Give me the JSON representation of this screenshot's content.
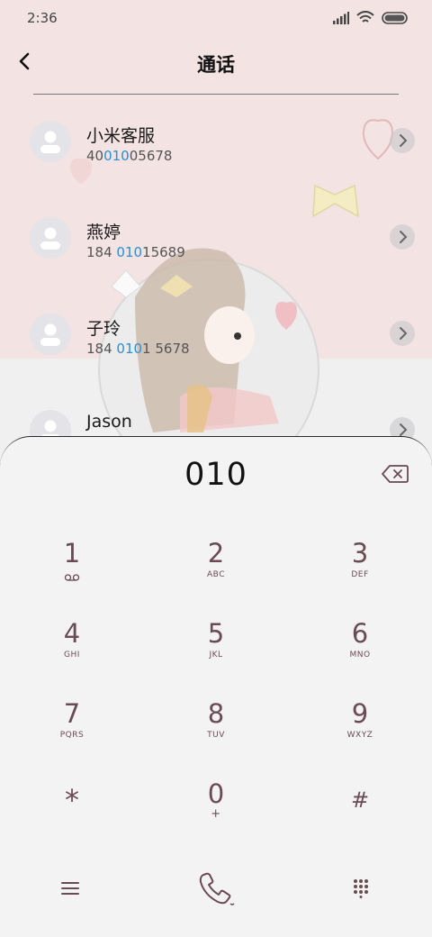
{
  "status_bar": {
    "time": "2:36"
  },
  "header": {
    "title": "通话"
  },
  "contacts": [
    {
      "name": "小米客服",
      "num_pre": "40",
      "num_hl": "010",
      "num_post": "05678"
    },
    {
      "name": "燕婷",
      "num_pre": "184 ",
      "num_hl": "010",
      "num_post": "15689"
    },
    {
      "name": "子玲",
      "num_pre": "184 ",
      "num_hl": "010",
      "num_post": "1 5678"
    },
    {
      "name": "Jason",
      "num_pre": "",
      "num_hl": "",
      "num_post": ""
    }
  ],
  "dialer": {
    "number": "010",
    "keys": [
      {
        "digit": "1",
        "letters": ""
      },
      {
        "digit": "2",
        "letters": "ABC"
      },
      {
        "digit": "3",
        "letters": "DEF"
      },
      {
        "digit": "4",
        "letters": "GHI"
      },
      {
        "digit": "5",
        "letters": "JKL"
      },
      {
        "digit": "6",
        "letters": "MNO"
      },
      {
        "digit": "7",
        "letters": "PQRS"
      },
      {
        "digit": "8",
        "letters": "TUV"
      },
      {
        "digit": "9",
        "letters": "WXYZ"
      },
      {
        "digit": "*",
        "letters": ""
      },
      {
        "digit": "0",
        "letters": "+"
      },
      {
        "digit": "#",
        "letters": ""
      }
    ]
  },
  "colors": {
    "accent": "#2b8fd0",
    "key_text": "#6a4a53",
    "top_bg": "#f3e3e3"
  },
  "icons": [
    "back-arrow-icon",
    "backspace-icon",
    "voicemail-icon",
    "menu-icon",
    "phone-call-icon",
    "keypad-icon"
  ]
}
